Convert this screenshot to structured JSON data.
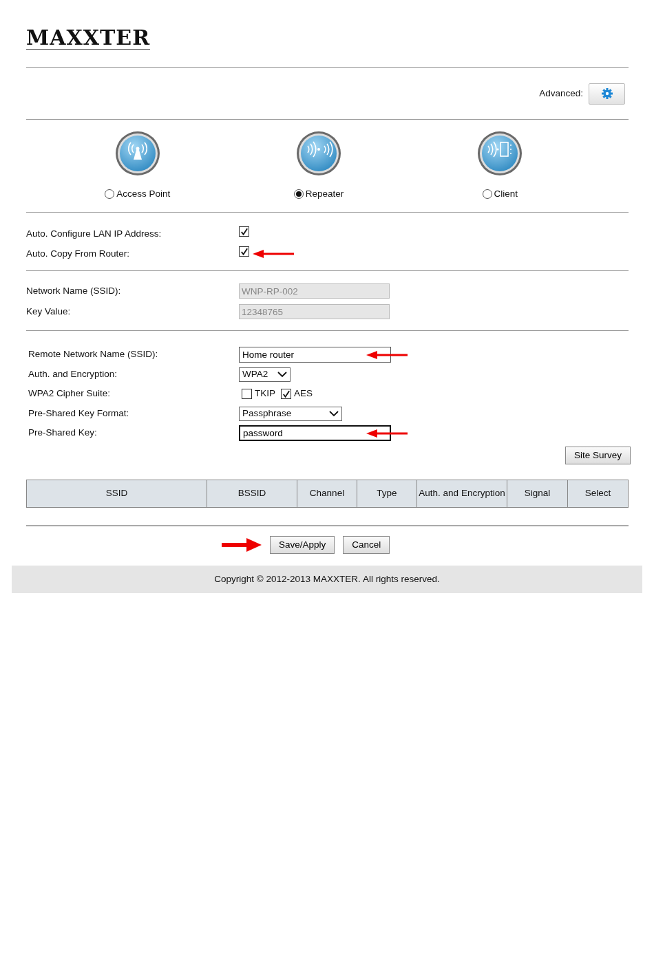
{
  "logo": "MAXXTER",
  "advanced": {
    "label": "Advanced:"
  },
  "modes": [
    {
      "label": "Access Point",
      "selected": false
    },
    {
      "label": "Repeater",
      "selected": true
    },
    {
      "label": "Client",
      "selected": false
    }
  ],
  "auto_settings": [
    {
      "label": "Auto. Configure LAN IP Address:",
      "checked": true,
      "arrow": false
    },
    {
      "label": "Auto. Copy From Router:",
      "checked": true,
      "arrow": true
    }
  ],
  "network": [
    {
      "label": "Network Name (SSID):",
      "value": "WNP-RP-002",
      "disabled": true
    },
    {
      "label": "Key Value:",
      "value": "12348765",
      "disabled": true
    }
  ],
  "remote": [
    {
      "kind": "text",
      "label": "Remote Network Name (SSID):",
      "value": "Home router",
      "focused": false,
      "arrow": true
    },
    {
      "kind": "select",
      "label": "Auth. and Encryption:",
      "value": "WPA2"
    },
    {
      "kind": "checks",
      "label": "WPA2 Cipher Suite:",
      "options": [
        {
          "label": "TKIP",
          "checked": false
        },
        {
          "label": "AES",
          "checked": true
        }
      ]
    },
    {
      "kind": "select",
      "label": "Pre-Shared Key Format:",
      "value": "Passphrase"
    },
    {
      "kind": "text",
      "label": "Pre-Shared Key:",
      "value": "password",
      "focused": true,
      "arrow": true
    }
  ],
  "site_survey": "Site Survey",
  "table": {
    "columns": [
      "SSID",
      "BSSID",
      "Channel",
      "Type",
      "Auth. and Encryption",
      "Signal",
      "Select"
    ]
  },
  "buttons": [
    {
      "label": "Save/Apply",
      "arrow": true
    },
    {
      "label": "Cancel",
      "arrow": false
    }
  ],
  "footer": "Copyright © 2012-2013 MAXXTER. All rights reserved."
}
